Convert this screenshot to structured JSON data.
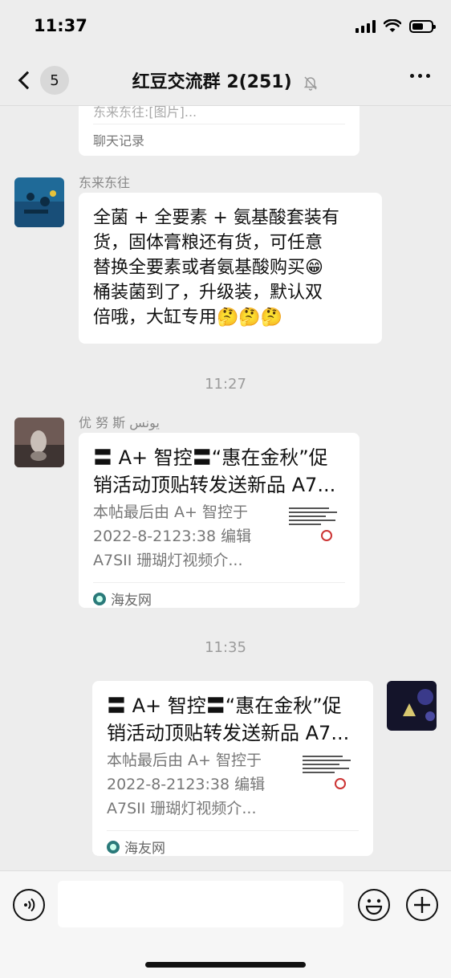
{
  "status_bar": {
    "time": "11:37"
  },
  "nav": {
    "unread_count": "5",
    "title": "红豆交流群 2(251)"
  },
  "chat": {
    "forward_card": {
      "preview_text": "东来东往:[图片]...",
      "footer": "聊天记录"
    },
    "messages": [
      {
        "sender": "东来东往",
        "lines": [
          "全菌 + 全要素 + 氨基酸套装有",
          "货，固体膏粮还有货，可任意",
          "替换全要素或者氨基酸购买😁",
          "桶装菌到了，升级装，默认双",
          "倍哦，大缸专用🤔🤔🤔"
        ]
      }
    ],
    "timestamp_1": "11:27",
    "link_message_1": {
      "sender": "优 努 斯  يونس",
      "title_lines": [
        "〓 A+ 智控〓“惠在金秋”促",
        "销活动顶贴转发送新品 A7..."
      ],
      "desc_lines": [
        "本帖最后由 A+ 智控于",
        "2022-8-2123:38 编辑",
        "A7SII 珊瑚灯视频介..."
      ],
      "source": "海友网"
    },
    "timestamp_2": "11:35",
    "link_message_2": {
      "title_lines": [
        "〓 A+ 智控〓“惠在金秋”促",
        "销活动顶贴转发送新品 A7..."
      ],
      "desc_lines": [
        "本帖最后由 A+ 智控于",
        "2022-8-2123:38 编辑",
        "A7SII 珊瑚灯视频介..."
      ],
      "source": "海友网"
    }
  },
  "input_bar": {
    "placeholder": ""
  },
  "icons": {
    "back": "chevron-left-icon",
    "mute": "bell-slash-icon",
    "more": "ellipsis-icon",
    "voice": "voice-icon",
    "emoji": "smiley-icon",
    "plus": "plus-icon"
  }
}
